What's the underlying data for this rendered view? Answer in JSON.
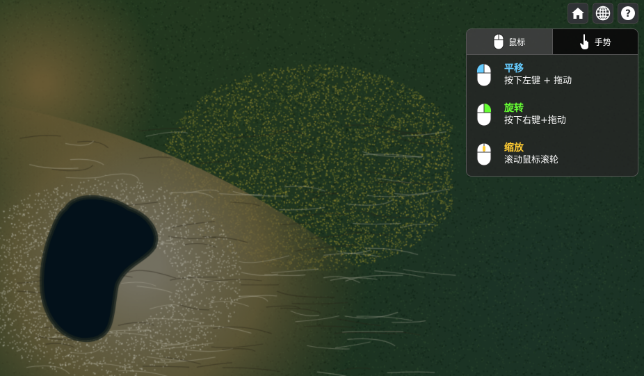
{
  "toolbar": {
    "buttons": [
      {
        "name": "home-button",
        "icon": "home-icon"
      },
      {
        "name": "scene-mode-button",
        "icon": "globe-icon"
      },
      {
        "name": "help-button",
        "icon": "question-icon"
      }
    ]
  },
  "navigation_help": {
    "tabs": [
      {
        "label": "鼠标",
        "icon": "mouse-icon",
        "active": true
      },
      {
        "label": "手势",
        "icon": "hand-pointer-icon",
        "active": false
      }
    ],
    "items": [
      {
        "title": "平移",
        "description": "按下左键 + 拖动",
        "color": "#66ccff",
        "icon": "mouse-left-icon"
      },
      {
        "title": "旋转",
        "description": "按下右键+拖动",
        "color": "#66ff33",
        "icon": "mouse-right-icon"
      },
      {
        "title": "缩放",
        "description": "滚动鼠标滚轮",
        "color": "#ffcc33",
        "icon": "mouse-wheel-icon"
      }
    ]
  },
  "colors": {
    "panel_background": "#262626",
    "forest": "#243d28",
    "lake": "#03111a",
    "button_background": "#303336"
  }
}
